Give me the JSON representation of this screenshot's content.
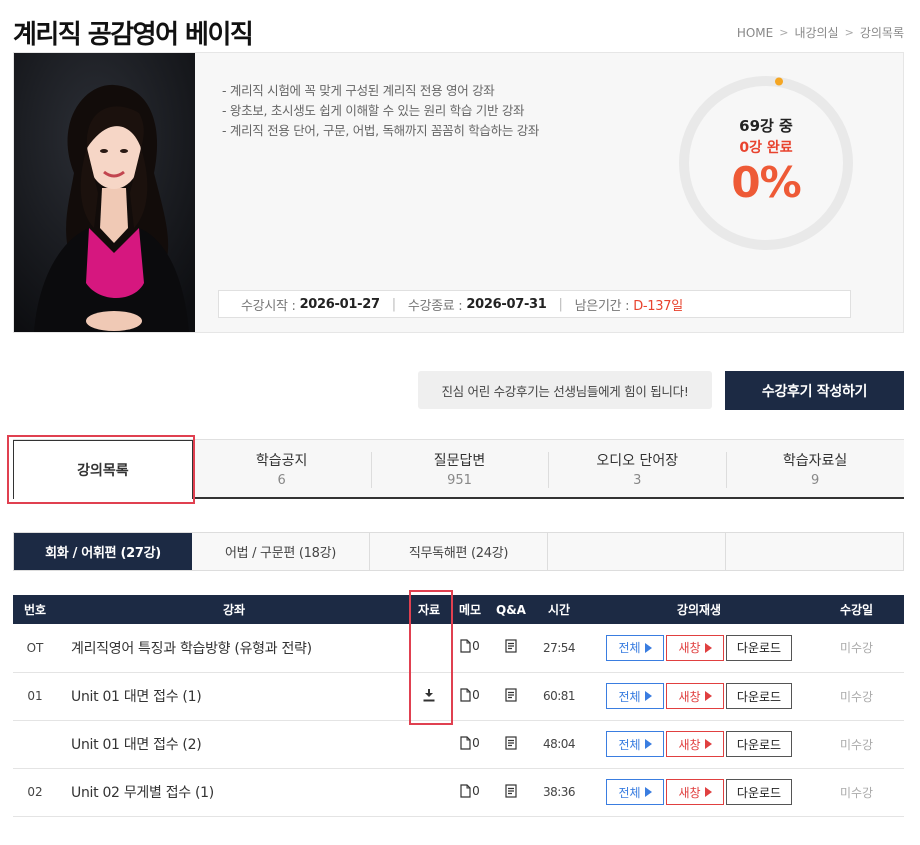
{
  "header": {
    "title": "계리직 공감영어 베이직",
    "breadcrumb": [
      "HOME",
      "내강의실",
      "강의목록"
    ]
  },
  "course": {
    "descriptions": [
      "- 계리직 시험에 꼭 맞게 구성된 계리직 전용 영어 강좌",
      "- 왕초보, 초시생도 쉽게 이해할 수 있는 원리 학습 기반 강좌",
      "- 계리직 전용 단어, 구문, 어법, 독해까지 꼼꼼히 학습하는 강좌"
    ],
    "start_label": "수강시작 :",
    "start_date": "2026-01-27",
    "end_label": "수강종료 :",
    "end_date": "2026-07-31",
    "remain_label": "남은기간 :",
    "remain_value": "D-137일",
    "progress": {
      "total": "69강 중",
      "done": "0강 완료",
      "percent": "0%",
      "fraction": 0.0
    }
  },
  "review": {
    "note": "진심 어린 수강후기는 선생님들에게 힘이 됩니다!",
    "button": "수강후기 작성하기"
  },
  "main_tabs": [
    {
      "label": "강의목록",
      "count": ""
    },
    {
      "label": "학습공지",
      "count": "6"
    },
    {
      "label": "질문답변",
      "count": "951"
    },
    {
      "label": "오디오 단어장",
      "count": "3"
    },
    {
      "label": "학습자료실",
      "count": "9"
    }
  ],
  "sub_tabs": [
    "회화 / 어휘편 (27강)",
    "어법 / 구문편 (18강)",
    "직무독해편 (24강)"
  ],
  "table": {
    "headers": [
      "번호",
      "강좌",
      "자료",
      "메모",
      "Q&A",
      "시간",
      "강의재생",
      "수강일"
    ],
    "rows": [
      {
        "num": "OT",
        "title": "계리직영어 특징과 학습방향 (유형과 전략)",
        "memo": "0",
        "time": "27:54",
        "status": "미수강",
        "has_file": false
      },
      {
        "num": "01",
        "title": "Unit 01 대면 접수 (1)",
        "memo": "0",
        "time": "60:81",
        "status": "미수강",
        "has_file": true
      },
      {
        "num": "",
        "title": "Unit 01 대면 접수 (2)",
        "memo": "0",
        "time": "48:04",
        "status": "미수강",
        "has_file": false
      },
      {
        "num": "02",
        "title": "Unit 02 무게별 접수 (1)",
        "memo": "0",
        "time": "38:36",
        "status": "미수강",
        "has_file": false
      }
    ],
    "buttons": {
      "all": "전체",
      "new": "새창",
      "download": "다운로드"
    }
  },
  "colors": {
    "navy": "#1c2a44",
    "accent_red": "#e8432e",
    "progress_orange": "#f5a623",
    "blue_button": "#3a7de0",
    "highlight": "#e04050"
  }
}
